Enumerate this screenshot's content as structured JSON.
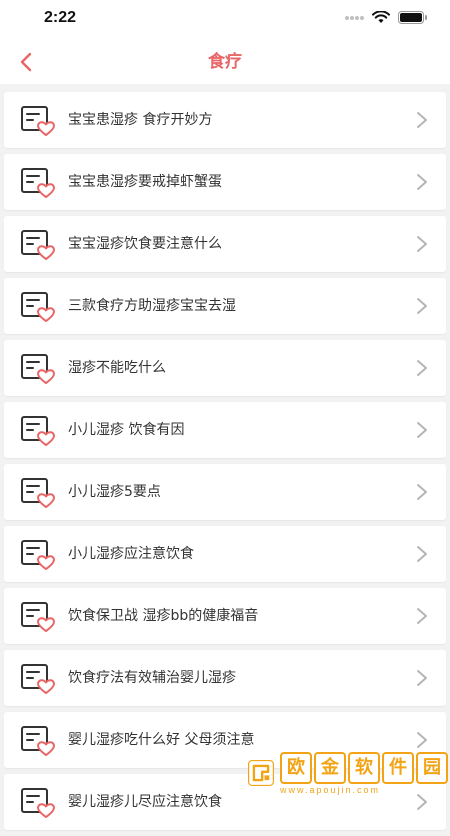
{
  "status_bar": {
    "time": "2:22"
  },
  "nav": {
    "title": "食疗",
    "back_icon": "chevron-left-icon"
  },
  "colors": {
    "accent": "#e86666",
    "text": "#333333",
    "background": "#f2f2f2",
    "watermark": "#f2a416"
  },
  "list": {
    "item_icon": "article-heart-icon",
    "items": [
      {
        "label": "宝宝患湿疹 食疗开妙方"
      },
      {
        "label": "宝宝患湿疹要戒掉虾蟹蛋"
      },
      {
        "label": "宝宝湿疹饮食要注意什么"
      },
      {
        "label": "三款食疗方助湿疹宝宝去湿"
      },
      {
        "label": "湿疹不能吃什么"
      },
      {
        "label": "小儿湿疹 饮食有因"
      },
      {
        "label": "小儿湿疹5要点"
      },
      {
        "label": "小儿湿疹应注意饮食"
      },
      {
        "label": "饮食保卫战 湿疹bb的健康福音"
      },
      {
        "label": "饮食疗法有效辅治婴儿湿疹"
      },
      {
        "label": "婴儿湿疹吃什么好 父母须注意"
      },
      {
        "label": "婴儿湿疹儿尽应注意饮食"
      }
    ]
  },
  "watermark": {
    "chars": [
      "欧",
      "金",
      "软",
      "件",
      "园"
    ],
    "url": "www.apoujin.com"
  }
}
